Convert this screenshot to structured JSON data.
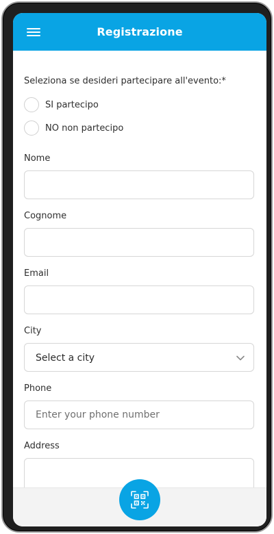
{
  "header": {
    "title": "Registrazione",
    "menu_icon": "hamburger-menu-icon"
  },
  "form": {
    "question": "Seleziona se desideri partecipare all'evento:*",
    "participation_options": [
      {
        "label": "SI partecipo",
        "selected": false
      },
      {
        "label": "NO non partecipo",
        "selected": false
      }
    ],
    "fields": {
      "nome": {
        "label": "Nome",
        "value": "",
        "placeholder": ""
      },
      "cognome": {
        "label": "Cognome",
        "value": "",
        "placeholder": ""
      },
      "email": {
        "label": "Email",
        "value": "",
        "placeholder": ""
      },
      "city": {
        "label": "City",
        "selected": "Select a city"
      },
      "phone": {
        "label": "Phone",
        "value": "",
        "placeholder": "Enter your phone number"
      },
      "address": {
        "label": "Address",
        "value": "",
        "placeholder": ""
      }
    }
  },
  "fab": {
    "icon": "qr-code-scan-icon"
  },
  "colors": {
    "accent": "#09a4e4",
    "border": "#d6d6d6",
    "text": "#2e2e2e"
  }
}
